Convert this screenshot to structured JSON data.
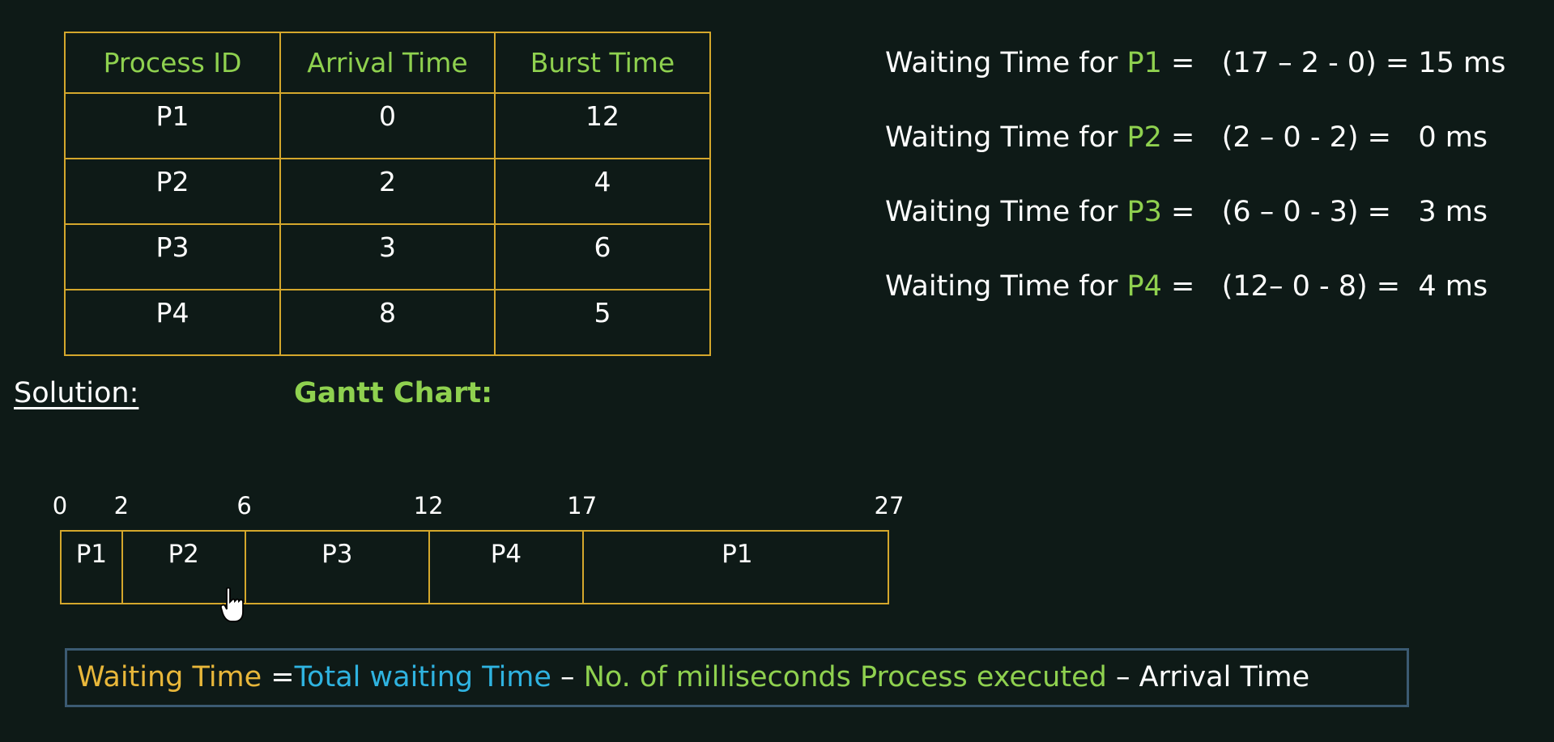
{
  "process_table": {
    "headers": [
      "Process ID",
      "Arrival Time",
      "Burst Time"
    ],
    "rows": [
      [
        "P1",
        "0",
        "12"
      ],
      [
        "P2",
        "2",
        "4"
      ],
      [
        "P3",
        "3",
        "6"
      ],
      [
        "P4",
        "8",
        "5"
      ]
    ]
  },
  "waiting_times": [
    {
      "prefix": "Waiting Time for ",
      "pid": "P1",
      "expr": " =   (17 – 2 - 0) = 15 ms"
    },
    {
      "prefix": "Waiting Time for ",
      "pid": "P2",
      "expr": " =   (2 – 0 - 2) =   0 ms"
    },
    {
      "prefix": "Waiting Time for ",
      "pid": "P3",
      "expr": " =   (6 – 0 - 3) =   3 ms"
    },
    {
      "prefix": "Waiting Time for ",
      "pid": "P4",
      "expr": " =   (12– 0 - 8) =  4 ms"
    }
  ],
  "solution_label": "Solution",
  "solution_colon": ":",
  "gantt_title": "Gantt Chart:",
  "gantt": {
    "ticks": [
      "0",
      "2",
      "6",
      "12",
      "17",
      "27"
    ],
    "blocks": [
      {
        "label": "P1",
        "start": 0,
        "end": 2
      },
      {
        "label": "P2",
        "start": 2,
        "end": 6
      },
      {
        "label": "P3",
        "start": 6,
        "end": 12
      },
      {
        "label": "P4",
        "start": 12,
        "end": 17
      },
      {
        "label": "P1",
        "start": 17,
        "end": 27
      }
    ]
  },
  "formula": {
    "waiting": "Waiting Time ",
    "eq": "=",
    "total": "Total waiting Time",
    "dash1": " – ",
    "ms_executed": "No. of milliseconds Process executed",
    "dash2": " – ",
    "arrival": "Arrival Time"
  },
  "colors": {
    "background": "#0e1a17",
    "table_border": "#d4a72c",
    "highlight_green": "#8fd14f",
    "formula_yellow": "#e8b73a",
    "formula_blue": "#2fb3e0",
    "formula_box_border": "#3b5a72"
  },
  "icons": {
    "cursor": "hand-pointer-icon"
  }
}
